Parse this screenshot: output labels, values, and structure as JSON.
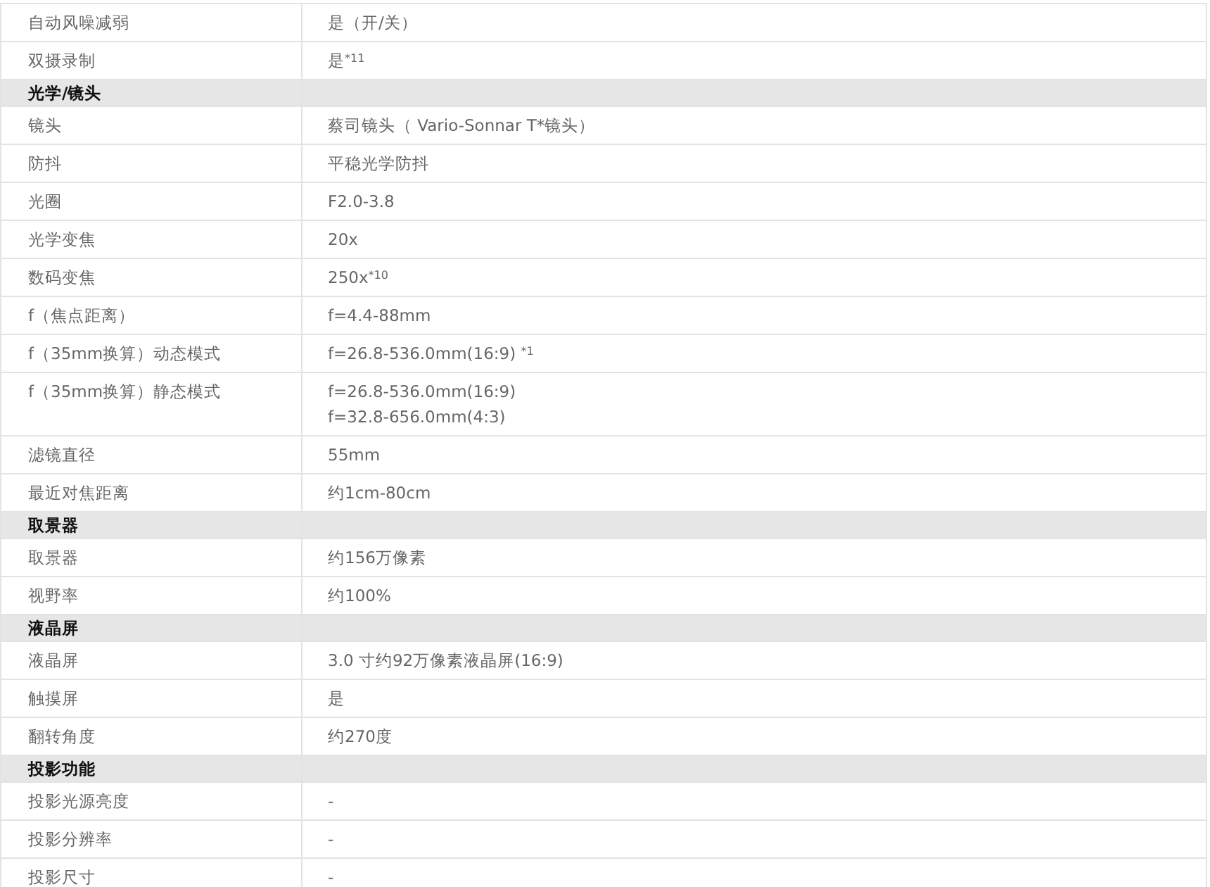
{
  "groups": [
    {
      "rows": [
        {
          "label": "自动风噪减弱",
          "lines": [
            "是（开/关）"
          ]
        },
        {
          "label": "双摄录制",
          "lines": [
            "是$^{*11}$"
          ]
        }
      ]
    },
    {
      "heading": "光学/镜头",
      "rows": [
        {
          "label": "镜头",
          "lines": [
            "蔡司镜头（ Vario-Sonnar T*镜头）"
          ]
        },
        {
          "label": "防抖",
          "lines": [
            "平稳光学防抖"
          ]
        },
        {
          "label": "光圈",
          "lines": [
            "F2.0-3.8"
          ]
        },
        {
          "label": "光学变焦",
          "lines": [
            "20x"
          ]
        },
        {
          "label": "数码变焦",
          "lines": [
            "250x$^{*10}$"
          ]
        },
        {
          "label": "f（焦点距离）",
          "lines": [
            "f=4.4-88mm"
          ]
        },
        {
          "label": "f（35mm换算）动态模式",
          "lines": [
            "f=26.8-536.0mm(16:9) $^{*1}$"
          ]
        },
        {
          "label": "f（35mm换算）静态模式",
          "lines": [
            "f=26.8-536.0mm(16:9)",
            "f=32.8-656.0mm(4:3)"
          ]
        },
        {
          "label": "滤镜直径",
          "lines": [
            "55mm"
          ]
        },
        {
          "label": "最近对焦距离",
          "lines": [
            "约1cm-80cm"
          ]
        }
      ]
    },
    {
      "heading": "取景器",
      "rows": [
        {
          "label": "取景器",
          "lines": [
            "约156万像素"
          ]
        },
        {
          "label": "视野率",
          "lines": [
            "约100%"
          ]
        }
      ]
    },
    {
      "heading": "液晶屏",
      "rows": [
        {
          "label": "液晶屏",
          "lines": [
            "3.0 寸约92万像素液晶屏(16:9)"
          ]
        },
        {
          "label": "触摸屏",
          "lines": [
            "是"
          ]
        },
        {
          "label": "翻转角度",
          "lines": [
            "约270度"
          ]
        }
      ]
    },
    {
      "heading": "投影功能",
      "rows": [
        {
          "label": "投影光源亮度",
          "lines": [
            "-"
          ]
        },
        {
          "label": "投影分辨率",
          "lines": [
            "-"
          ]
        },
        {
          "label": "投影尺寸",
          "lines": [
            "-"
          ]
        }
      ]
    }
  ]
}
